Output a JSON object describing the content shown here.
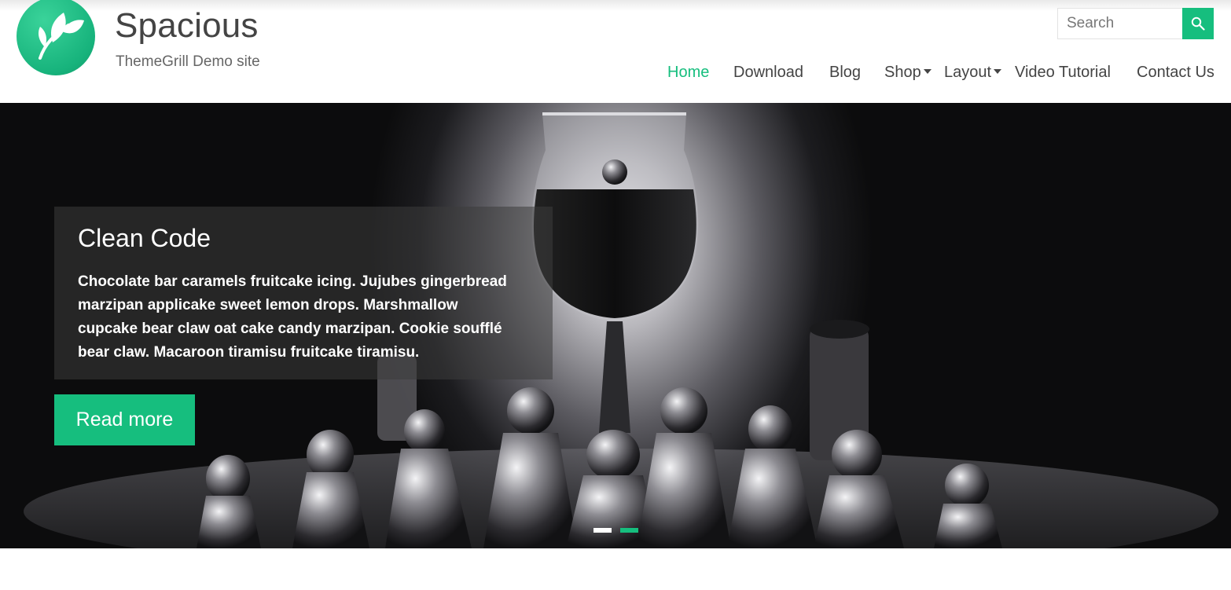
{
  "site": {
    "title": "Spacious",
    "description": "ThemeGrill Demo site",
    "logo_icon": "leaf-icon"
  },
  "search": {
    "placeholder": "Search",
    "button_icon": "search-icon"
  },
  "nav": {
    "items": [
      {
        "label": "Home",
        "active": true
      },
      {
        "label": "Download"
      },
      {
        "label": "Blog"
      },
      {
        "label": "Shop",
        "has_dropdown": true
      },
      {
        "label": "Layout",
        "has_dropdown": true
      },
      {
        "label": "Video Tutorial"
      },
      {
        "label": "Contact Us"
      }
    ]
  },
  "slider": {
    "title": "Clean Code",
    "text": "Chocolate bar caramels fruitcake icing. Jujubes gingerbread marzipan applicake sweet lemon drops. Marshmallow cupcake bear claw oat cake candy marzipan. Cookie soufflé bear claw. Macaroon tiramisu fruitcake tiramisu.",
    "button_label": "Read more",
    "slide_count": 2,
    "active_slide": 2
  },
  "colors": {
    "accent": "#16be7e",
    "text": "#444444"
  }
}
